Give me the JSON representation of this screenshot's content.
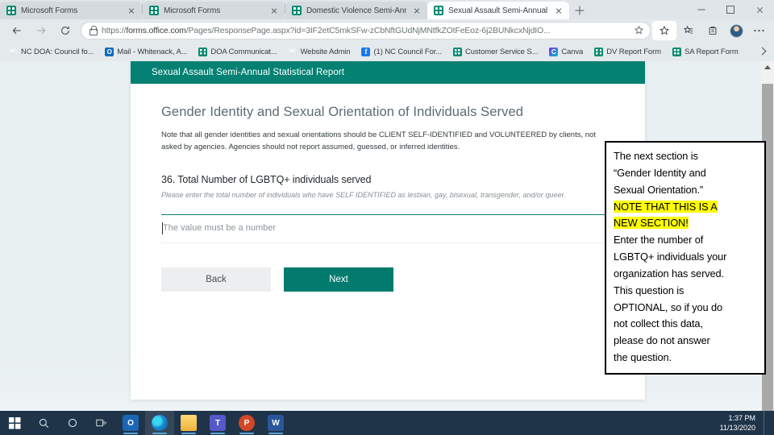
{
  "browser": {
    "tabs": [
      {
        "title": "Microsoft Forms",
        "icon": "forms-icon",
        "active": false
      },
      {
        "title": "Microsoft Forms",
        "icon": "forms-icon",
        "active": false
      },
      {
        "title": "Domestic Violence Semi-Annual",
        "icon": "forms-icon",
        "active": false
      },
      {
        "title": "Sexual Assault Semi-Annual Stati",
        "icon": "forms-icon",
        "active": true
      }
    ],
    "new_tab_label": "+",
    "window_controls": {
      "minimize": "minimize-icon",
      "maximize": "maximize-icon",
      "close": "close-icon"
    },
    "nav": {
      "back": "back-arrow-icon",
      "forward": "forward-arrow-icon",
      "refresh": "refresh-icon"
    },
    "address": {
      "lock": "lock-icon",
      "url_scheme": "https://",
      "url_host": "forms.office.com",
      "url_path": "/Pages/ResponsePage.aspx?id=3IF2etC5mkSFw-zCbNftGUdNjMNtfkZOtFeEoz-6j2BUNkcxNjdIO...",
      "star": "favorite-star-icon"
    },
    "toolbar_icons": [
      {
        "name": "favorites-star-icon"
      },
      {
        "name": "collections-icon"
      },
      {
        "name": "profile-avatar"
      },
      {
        "name": "settings-more-icon"
      }
    ],
    "bookmarks": [
      {
        "label": "NC DOA: Council fo...",
        "icon": "nc-icon"
      },
      {
        "label": "Mail - Whitenack, A...",
        "icon": "outlook-icon"
      },
      {
        "label": "DOA Communicat...",
        "icon": "forms-icon"
      },
      {
        "label": "Website Admin",
        "icon": "nc-icon"
      },
      {
        "label": "(1) NC Council For...",
        "icon": "facebook-icon"
      },
      {
        "label": "Customer Service S...",
        "icon": "forms-icon"
      },
      {
        "label": "Canva",
        "icon": "canva-icon"
      },
      {
        "label": "DV Report Form",
        "icon": "forms-icon"
      },
      {
        "label": "SA Report Form",
        "icon": "forms-icon"
      }
    ],
    "bookmarks_overflow": "bookmarks-overflow-chevron"
  },
  "form": {
    "header_title": "Sexual Assault Semi-Annual Statistical Report",
    "section_title": "Gender Identity and Sexual Orientation of Individuals Served",
    "section_note": "Note that all gender identities and sexual orientations should be CLIENT SELF-IDENTIFIED and VOLUNTEERED by clients, not asked by agencies. Agencies should not report assumed, guessed, or inferred identities.",
    "question": {
      "number": "36.",
      "title": "Total Number of LGBTQ+ individuals served",
      "subtitle": "Please enter the total number of individuals who have SELF IDENTIFIED as lesbian, gay, bisexual, transgender, and/or queer.",
      "input_value": "",
      "input_placeholder": "The value must be a number"
    },
    "buttons": {
      "back": "Back",
      "next": "Next"
    },
    "accent_color": "#048173"
  },
  "callout": {
    "line1": "The next section is",
    "line2": "“Gender Identity and",
    "line3": "Sexual Orientation.”",
    "highlight1": "NOTE THAT THIS IS A",
    "highlight2": "NEW SECTION!",
    "line4": "Enter the number of",
    "line5": "LGBTQ+ individuals your",
    "line6": "organization has served.",
    "line7": "This question is",
    "line8": "OPTIONAL, so if you do",
    "line9": "not collect this data,",
    "line10": "please do not answer",
    "line11": "the question.",
    "highlight_color": "#ffff00"
  },
  "taskbar": {
    "start": "windows-start-icon",
    "search": "search-icon",
    "cortana": "cortana-icon",
    "task_view": "task-view-icon",
    "apps": [
      {
        "name": "outlook-taskbar-icon",
        "glyph": "O",
        "running": true,
        "active": false
      },
      {
        "name": "edge-taskbar-icon",
        "glyph": "",
        "running": true,
        "active": true
      },
      {
        "name": "file-explorer-taskbar-icon",
        "glyph": "",
        "running": true,
        "active": false
      },
      {
        "name": "teams-taskbar-icon",
        "glyph": "T",
        "running": true,
        "active": false
      },
      {
        "name": "powerpoint-taskbar-icon",
        "glyph": "P",
        "running": true,
        "active": false
      },
      {
        "name": "word-taskbar-icon",
        "glyph": "W",
        "running": true,
        "active": false
      }
    ],
    "time": "1:37 PM",
    "date": "11/13/2020"
  }
}
